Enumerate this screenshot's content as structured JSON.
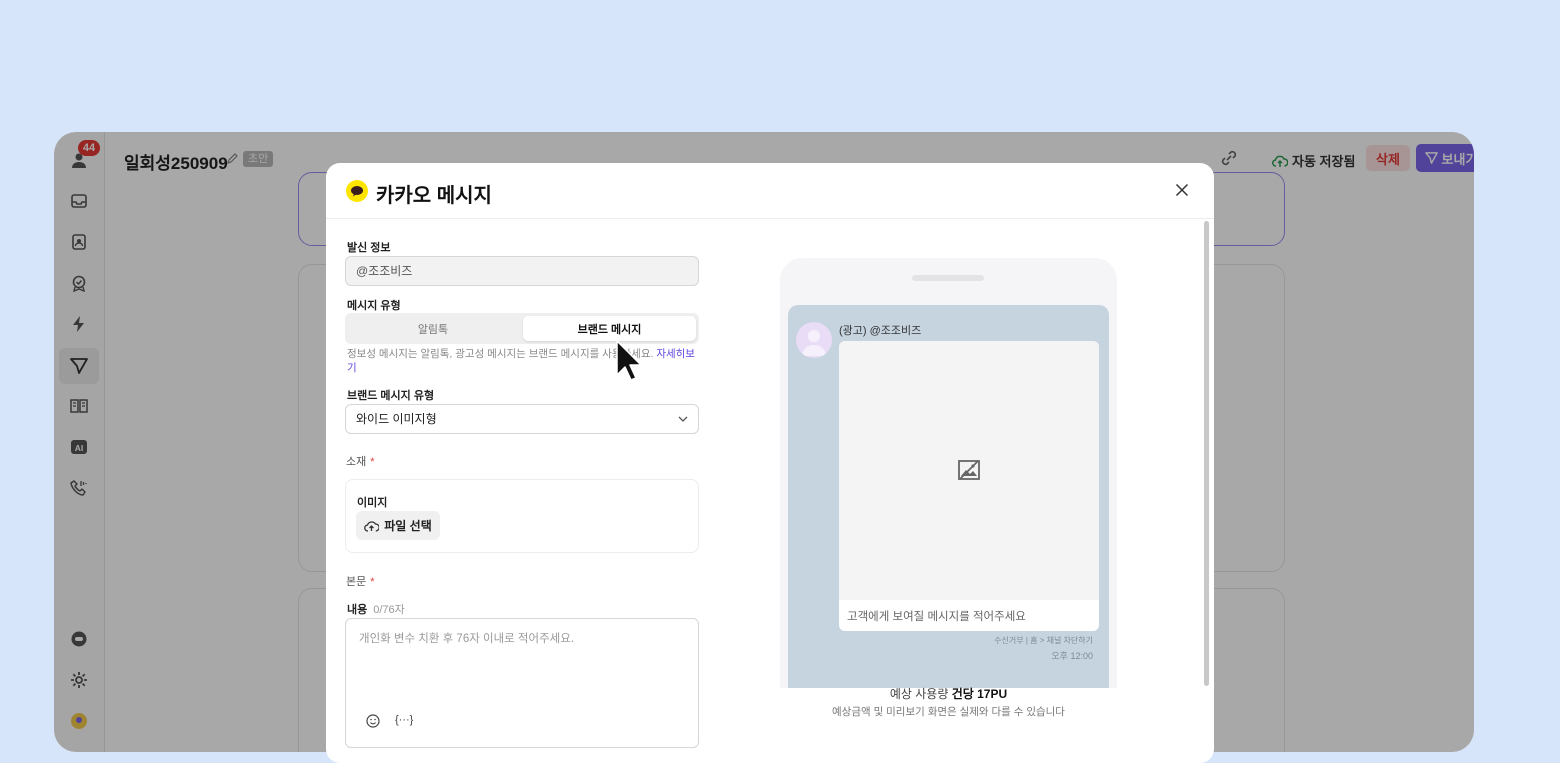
{
  "app": {
    "title": "일회성250909",
    "draft_badge": "초안",
    "autosave_label": "자동 저장됨",
    "delete_label": "삭제",
    "send_label": "보내기",
    "notification_count": "44",
    "accent_color": "#7b64ea"
  },
  "sidebar": {
    "icons": [
      "profile-icon",
      "inbox-icon",
      "contacts-icon",
      "badge-check-icon",
      "lightning-icon",
      "send-icon",
      "book-icon",
      "ai-icon",
      "phone-icon",
      "chat-bubble-icon",
      "gear-icon",
      "user-avatar"
    ],
    "active": "send-icon"
  },
  "modal": {
    "title": "카카오 메시지",
    "sender": {
      "label": "발신 정보",
      "value": "@조조비즈"
    },
    "message_type": {
      "label": "메시지 유형",
      "options": [
        "알림톡",
        "브랜드 메시지"
      ],
      "selected": "브랜드 메시지",
      "helper": "정보성 메시지는 알림톡, 광고성 메시지는 브랜드 메시지를 사용하세요.",
      "helper_link": "자세히보기"
    },
    "brand_type": {
      "label": "브랜드 메시지 유형",
      "value": "와이드 이미지형"
    },
    "material": {
      "label": "소재",
      "required_mark": "*",
      "image_label": "이미지",
      "file_button": "파일 선택"
    },
    "body": {
      "label": "본문",
      "required_mark": "*",
      "content_label": "내용",
      "counter": "0/76자",
      "placeholder": "개인화 변수 치환 후 76자 이내로 적어주세요.",
      "variable_button": "{···}"
    },
    "preview": {
      "sender_name": "(광고) @조조비즈",
      "bubble_placeholder": "고객에게 보여질 메시지를 적어주세요",
      "footer_meta": "수신거부 | 홈 > 채널 차단하기",
      "time": "오후 12:00",
      "estimate_label": "예상 사용량",
      "estimate_value": "건당 17PU",
      "estimate_note": "예상금액 및 미리보기 화면은 실제와 다를 수 있습니다"
    }
  }
}
